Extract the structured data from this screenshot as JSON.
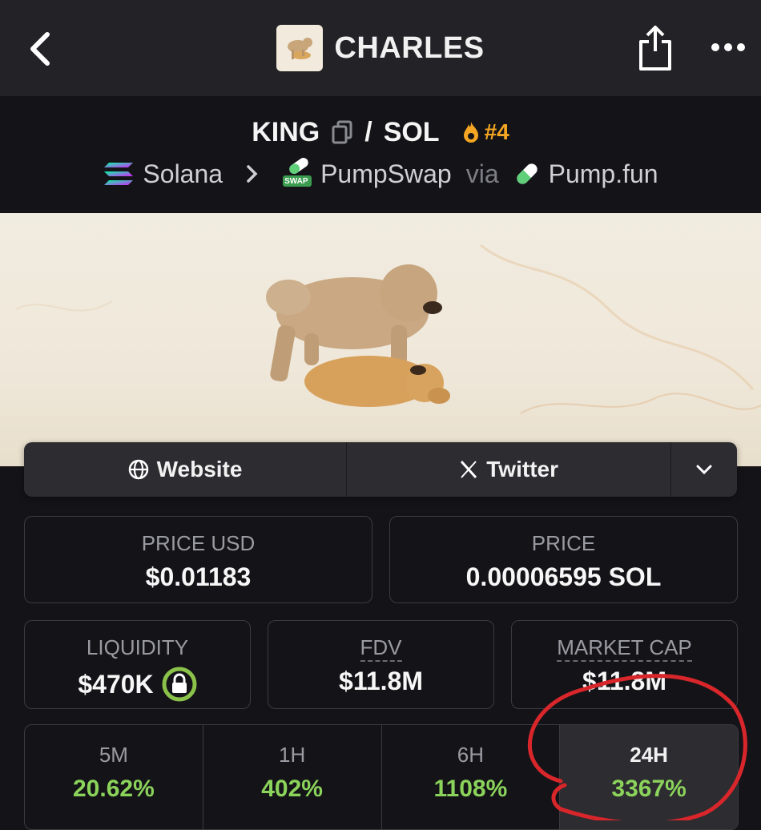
{
  "header": {
    "title": "CHARLES",
    "back_icon": "chevron-left-icon",
    "share_icon": "share-icon",
    "more_icon": "more-dots-icon"
  },
  "pair": {
    "base": "KING",
    "separator": "/",
    "quote": "SOL",
    "rank": "#4",
    "rank_color": "#f5a623"
  },
  "chain": {
    "network": "Solana",
    "dex": "PumpSwap",
    "dex_badge": "SWAP",
    "via": "via",
    "launchpad": "Pump.fun"
  },
  "links": {
    "website": "Website",
    "twitter": "Twitter",
    "dropdown_icon": "chevron-down-icon"
  },
  "stats": {
    "price_usd": {
      "label": "PRICE USD",
      "value": "$0.01183"
    },
    "price": {
      "label": "PRICE",
      "value": "0.00006595 SOL"
    },
    "liquidity": {
      "label": "LIQUIDITY",
      "value": "$470K"
    },
    "fdv": {
      "label": "FDV",
      "value": "$11.8M"
    },
    "market_cap": {
      "label": "MARKET CAP",
      "value": "$11.8M"
    }
  },
  "changes": [
    {
      "label": "5M",
      "value": "20.62%"
    },
    {
      "label": "1H",
      "value": "402%"
    },
    {
      "label": "6H",
      "value": "1108%"
    },
    {
      "label": "24H",
      "value": "3367%"
    }
  ],
  "colors": {
    "accent_green": "#8bd35a",
    "lock_green": "#8bc34a",
    "annotation_red": "#d8262b"
  }
}
